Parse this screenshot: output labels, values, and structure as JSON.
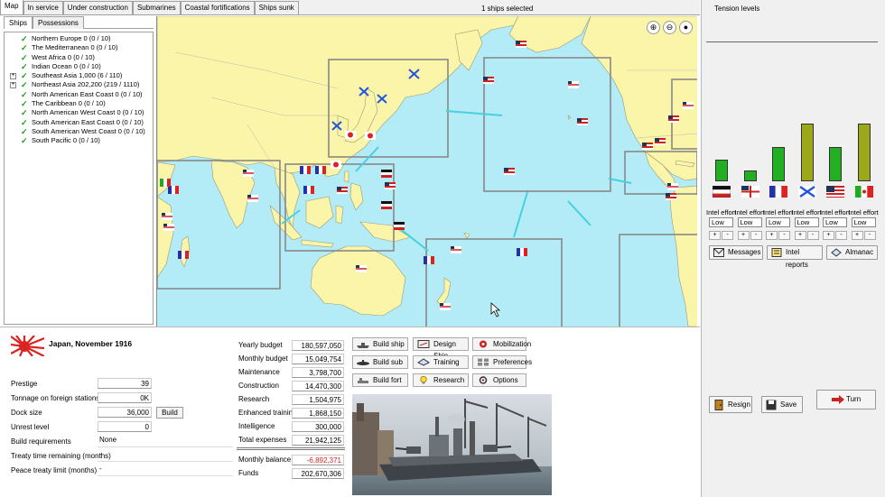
{
  "top_tabs": [
    {
      "label": "Map",
      "active": true
    },
    {
      "label": "In service"
    },
    {
      "label": "Under construction"
    },
    {
      "label": "Submarines"
    },
    {
      "label": "Coastal fortifications"
    },
    {
      "label": "Ships sunk"
    }
  ],
  "selection_status": "1 ships selected",
  "left_tabs": [
    {
      "label": "Ships",
      "active": true
    },
    {
      "label": "Possessions"
    }
  ],
  "regions": [
    {
      "label": "Northern Europe 0 (0 / 10)",
      "expandable": false
    },
    {
      "label": "The Mediterranean 0 (0 / 10)",
      "expandable": false
    },
    {
      "label": "West Africa 0 (0 / 10)",
      "expandable": false
    },
    {
      "label": "Indian Ocean 0 (0 / 10)",
      "expandable": false
    },
    {
      "label": "Southeast Asia 1,000 (6 / 110)",
      "expandable": true
    },
    {
      "label": "Northeast Asia 202,200 (219 / 1110)",
      "expandable": true
    },
    {
      "label": "North American East Coast 0 (0 / 10)",
      "expandable": false
    },
    {
      "label": "The Caribbean 0 (0 / 10)",
      "expandable": false
    },
    {
      "label": "North American West Coast 0 (0 / 10)",
      "expandable": false
    },
    {
      "label": "South American East Coast 0 (0 / 10)",
      "expandable": false
    },
    {
      "label": "South American West Coast 0 (0 / 10)",
      "expandable": false
    },
    {
      "label": "South Pacific 0 (0 / 10)",
      "expandable": false
    }
  ],
  "map_tools": [
    {
      "icon": "zoom-in-icon",
      "glyph": "⊕"
    },
    {
      "icon": "zoom-out-icon",
      "glyph": "⊖"
    },
    {
      "icon": "drop-icon",
      "glyph": "●"
    }
  ],
  "colors": {
    "ocean": "#b3ecf7",
    "land": "#faf5a8",
    "tension_green": "#22b022",
    "tension_olive": "#9aa81a",
    "negative": "#e02020"
  },
  "tension": {
    "title": "Tension levels",
    "nations": [
      {
        "flag": "germany-flag-icon",
        "level": 0.38,
        "color": "#22b022",
        "intel_label": "Intel effort",
        "intel_value": "Low"
      },
      {
        "flag": "britain-flag-icon",
        "level": 0.19,
        "color": "#22b022",
        "intel_label": "Intel effort",
        "intel_value": "Low"
      },
      {
        "flag": "france-flag-icon",
        "level": 0.59,
        "color": "#22b022",
        "intel_label": "Intel effort",
        "intel_value": "Low"
      },
      {
        "flag": "russia-flag-icon",
        "level": 1.0,
        "color": "#9aa81a",
        "intel_label": "Intel effort",
        "intel_value": "Low"
      },
      {
        "flag": "usa-flag-icon",
        "level": 0.59,
        "color": "#22b022",
        "intel_label": "Intel effort",
        "intel_value": "Low"
      },
      {
        "flag": "italy-flag-icon",
        "level": 1.0,
        "color": "#9aa81a",
        "intel_label": "Intel effort",
        "intel_value": "Low"
      }
    ]
  },
  "right_buttons": {
    "messages": "Messages",
    "intel_reports": "Intel reports",
    "almanac": "Almanac",
    "resign": "Resign",
    "save": "Save",
    "turn": "Turn"
  },
  "nation": {
    "title": "Japan, November 1916",
    "flag": "japan-rising-sun-flag-icon"
  },
  "stats": [
    {
      "label": "Prestige",
      "value": "39",
      "boxed": true
    },
    {
      "label": "Tonnage on foreign stations",
      "value": "0K",
      "boxed": true
    },
    {
      "label": "Dock size",
      "value": "36,000",
      "boxed": true
    },
    {
      "label": "Unrest level",
      "value": "0",
      "boxed": true
    },
    {
      "label": "Build requirements",
      "value": "None",
      "boxed": false
    },
    {
      "label": "Treaty time remaining (months)",
      "value": "-",
      "boxed": false
    },
    {
      "label": "Peace treaty limit (months)",
      "value": "-",
      "boxed": false
    }
  ],
  "dock_build_button": "Build",
  "budget": [
    {
      "label": "Yearly budget",
      "value": "180,597,050"
    },
    {
      "label": "Monthly budget",
      "value": "15,049,754"
    },
    {
      "label": "Maintenance",
      "value": "3,798,700"
    },
    {
      "label": "Construction",
      "value": "14,470,300"
    },
    {
      "label": "Research",
      "value": "1,504,975"
    },
    {
      "label": "Enhanced training",
      "value": "1,868,150"
    },
    {
      "label": "Intelligence",
      "value": "300,000"
    },
    {
      "label": "Total expenses",
      "value": "21,942,125"
    },
    {
      "label": "Monthly balance",
      "value": "-6,892,371",
      "negative": true
    },
    {
      "label": "Funds",
      "value": "202,670,306"
    }
  ],
  "actions": {
    "build_ship": "Build ship",
    "design_ship": "Design Ship",
    "mobilization": "Mobilization",
    "build_sub": "Build sub",
    "training": "Training",
    "preferences": "Preferences",
    "build_fort": "Build fort",
    "research": "Research",
    "options": "Options"
  }
}
